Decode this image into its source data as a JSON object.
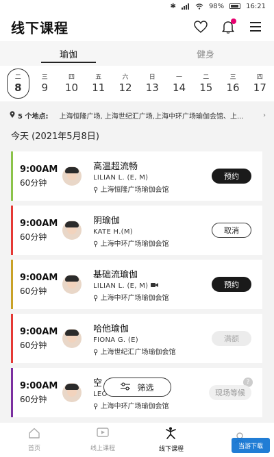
{
  "status_bar": {
    "battery": "98%",
    "time": "16:21"
  },
  "header": {
    "title": "线下课程"
  },
  "tabs": [
    {
      "label": "瑜伽"
    },
    {
      "label": "健身"
    }
  ],
  "dates": [
    {
      "dow": "二",
      "day": "8"
    },
    {
      "dow": "三",
      "day": "9"
    },
    {
      "dow": "四",
      "day": "10"
    },
    {
      "dow": "五",
      "day": "11"
    },
    {
      "dow": "六",
      "day": "12"
    },
    {
      "dow": "日",
      "day": "13"
    },
    {
      "dow": "一",
      "day": "14"
    },
    {
      "dow": "二",
      "day": "15"
    },
    {
      "dow": "三",
      "day": "16"
    },
    {
      "dow": "四",
      "day": "17"
    }
  ],
  "location": {
    "count": "5 个地点:",
    "places": "上海恒隆广场, 上海世纪汇广场,上海中环广场瑜伽会馆、上..."
  },
  "today_label": "今天 (2021年5月8日)",
  "classes": [
    {
      "time": "9:00AM",
      "duration": "60分钟",
      "name": "高温超流畅",
      "teacher": "LILIAN L. (E, M)",
      "venue": "上海恒隆广场瑜伽会馆",
      "button": "预约",
      "accent": "#8bc34a"
    },
    {
      "time": "9:00AM",
      "duration": "60分钟",
      "name": "阴瑜伽",
      "teacher": "KATE H.(M)",
      "venue": "上海中环广场瑜伽会馆",
      "button": "取消",
      "accent": "#e53935"
    },
    {
      "time": "9:00AM",
      "duration": "60分钟",
      "name": "基础流瑜伽",
      "teacher": "LILIAN L. (E, M)",
      "venue": "上海中环广场瑜伽会馆",
      "button": "预约",
      "accent": "#c9a227"
    },
    {
      "time": "9:00AM",
      "duration": "60分钟",
      "name": "哈他瑜伽",
      "teacher": "FIONA G. (E)",
      "venue": "上海世纪汇广场瑜伽会馆",
      "button": "满额",
      "accent": "#e53935"
    },
    {
      "time": "9:00AM",
      "duration": "60分钟",
      "name": "空",
      "teacher": "LEO",
      "venue": "上海中环广场瑜伽会馆",
      "button": "现场等候",
      "accent": "#7b2fa0"
    }
  ],
  "filter_label": "筛选",
  "bottom_nav": [
    {
      "label": "首页"
    },
    {
      "label": "线上课程"
    },
    {
      "label": "线下课程"
    },
    {
      "label": ""
    }
  ],
  "watermark": "当游下载"
}
